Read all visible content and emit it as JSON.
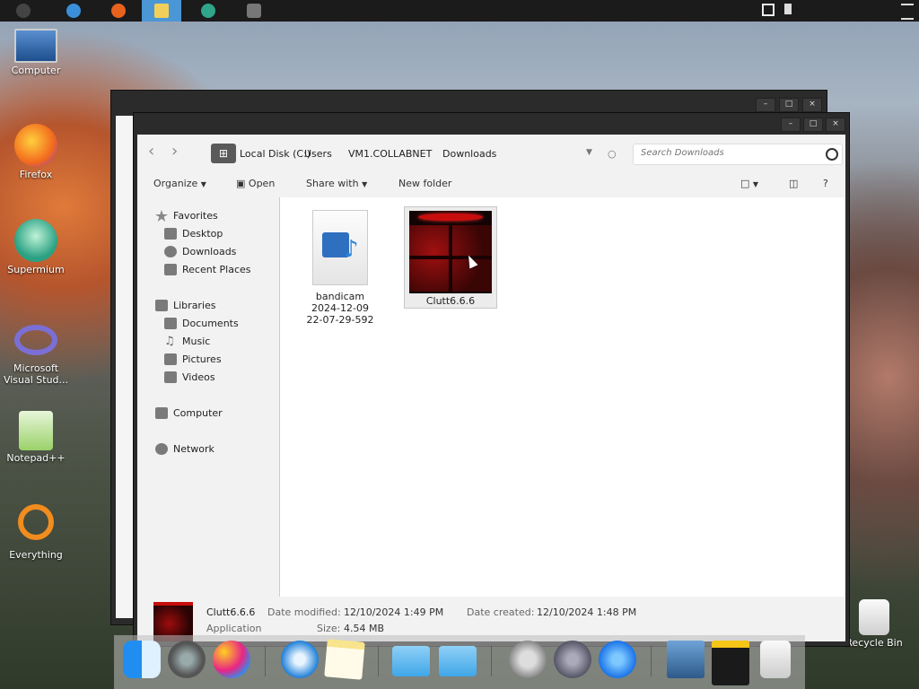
{
  "taskbar": {
    "items": [
      {
        "icon": "start-icon"
      },
      {
        "icon": "internet-explorer-icon"
      },
      {
        "icon": "firefox-icon"
      },
      {
        "icon": "file-explorer-icon",
        "active": true
      },
      {
        "icon": "supermium-icon"
      },
      {
        "icon": "camera-app-icon"
      }
    ],
    "tray": [
      "network-icon",
      "volume-muted-icon",
      "menu-icon"
    ]
  },
  "desktop": {
    "icons": [
      {
        "label": "Computer",
        "icon": "computer-icon"
      },
      {
        "label": "Firefox",
        "icon": "firefox-icon"
      },
      {
        "label": "Supermium",
        "icon": "supermium-icon"
      },
      {
        "label": "Microsoft Visual Stud...",
        "icon": "visual-studio-icon"
      },
      {
        "label": "Notepad++",
        "icon": "notepadpp-icon"
      },
      {
        "label": "Everything",
        "icon": "everything-icon"
      },
      {
        "label": "Recycle Bin",
        "icon": "recycle-bin-icon"
      }
    ]
  },
  "window": {
    "controls": {
      "minimize": "–",
      "maximize": "□",
      "close": "×"
    },
    "breadcrumb": [
      "Local Disk (C:)",
      "Users",
      "VM1.COLLABNET",
      "Downloads"
    ],
    "search": {
      "placeholder": "Search Downloads"
    },
    "toolbar": {
      "organize": "Organize",
      "open": "Open",
      "share_with": "Share with",
      "new_folder": "New folder",
      "help": "?"
    },
    "nav": {
      "favorites": "Favorites",
      "desktop": "Desktop",
      "downloads": "Downloads",
      "recent_places": "Recent Places",
      "libraries": "Libraries",
      "documents": "Documents",
      "music": "Music",
      "pictures": "Pictures",
      "videos": "Videos",
      "computer": "Computer",
      "network": "Network"
    },
    "files": [
      {
        "name_line1": "bandicam",
        "name_line2": "2024-12-09",
        "name_line3": "22-07-29-592",
        "icon": "video-file-icon"
      },
      {
        "name": "Clutt6.6.6",
        "icon": "application-icon",
        "selected": true
      }
    ],
    "details": {
      "name": "Clutt6.6.6",
      "type": "Application",
      "date_modified_label": "Date modified:",
      "date_modified": "12/10/2024 1:49 PM",
      "date_created_label": "Date created:",
      "date_created": "12/10/2024 1:48 PM",
      "size_label": "Size:",
      "size": "4.54 MB"
    }
  },
  "dock": {
    "items": [
      "finder-icon",
      "system-preferences-icon",
      "game-center-icon",
      "safari-icon",
      "notes-icon",
      "folder-icon",
      "applications-folder-icon",
      "power-icon",
      "launchpad-icon",
      "app-store-icon",
      "preview-icon",
      "photo-booth-icon",
      "trash-icon"
    ]
  }
}
